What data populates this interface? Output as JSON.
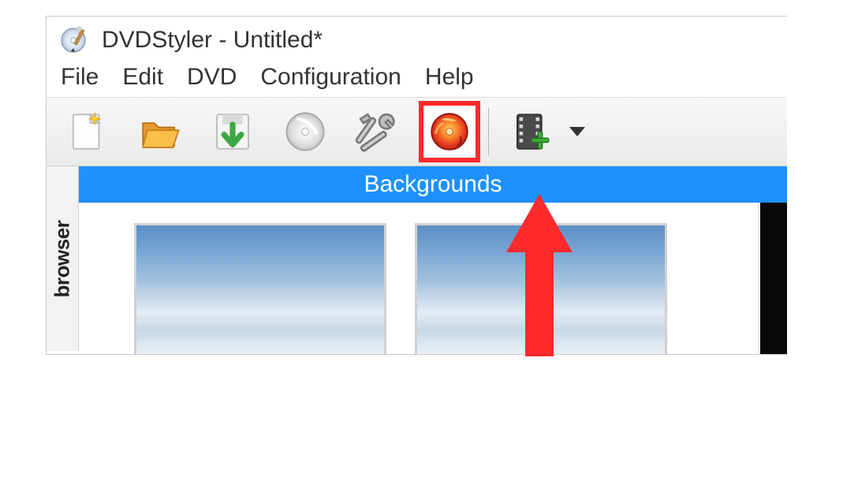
{
  "title": "DVDStyler - Untitled*",
  "menu": {
    "file": "File",
    "edit": "Edit",
    "dvd": "DVD",
    "configuration": "Configuration",
    "help": "Help"
  },
  "toolbar": {
    "new": "new-file-icon",
    "open": "open-folder-icon",
    "save": "save-icon",
    "preview": "preview-disc-icon",
    "tools": "tools-icon",
    "burn": "burn-disc-icon",
    "addvideo": "add-video-icon"
  },
  "sidebar": {
    "tab_label": "browser"
  },
  "panel": {
    "header": "Backgrounds"
  },
  "colors": {
    "highlight_red": "#ff2a2c",
    "header_blue": "#1e90ff"
  }
}
